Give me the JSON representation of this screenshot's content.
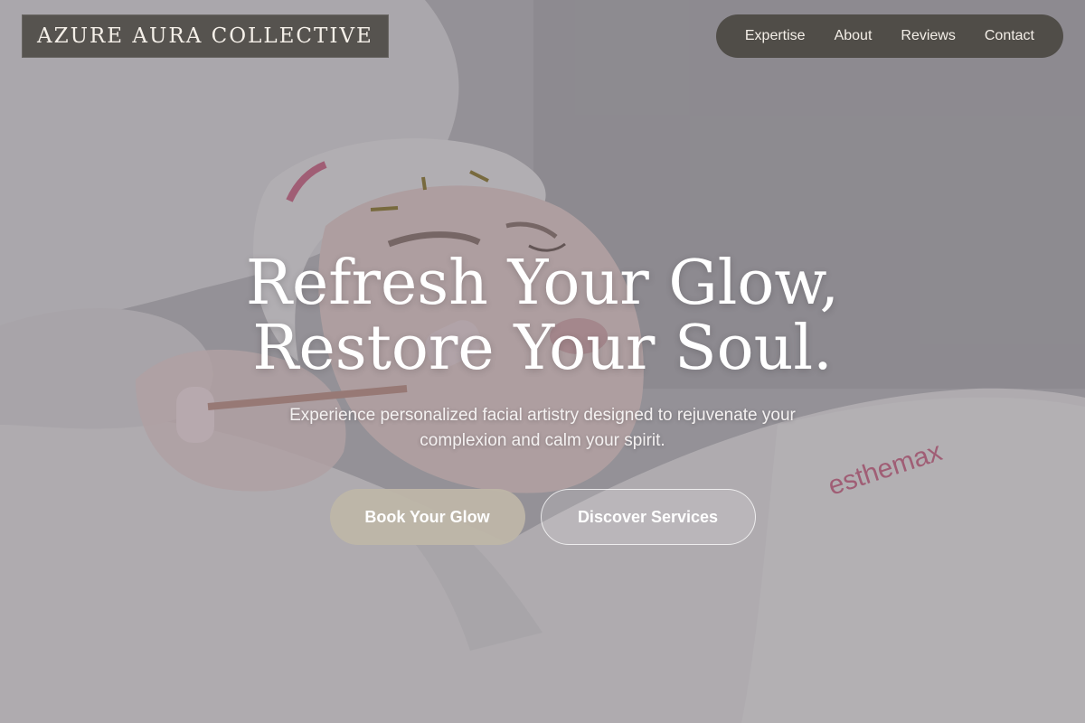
{
  "brand": {
    "name": "AZURE AURA COLLECTIVE"
  },
  "nav": {
    "items": [
      {
        "label": "Expertise"
      },
      {
        "label": "About"
      },
      {
        "label": "Reviews"
      },
      {
        "label": "Contact"
      }
    ]
  },
  "hero": {
    "headline_line1": "Refresh Your Glow,",
    "headline_line2": "Restore Your Soul.",
    "subheadline": "Experience personalized facial artistry designed to rejuvenate your complexion and calm your spirit.",
    "primary_cta": "Book Your Glow",
    "secondary_cta": "Discover Services",
    "background_image_subject": "spa-facial-rose-quartz-roller"
  },
  "colors": {
    "nav_bg": "#48443e",
    "primary_button": "#beb6a8",
    "text": "#ffffff"
  }
}
